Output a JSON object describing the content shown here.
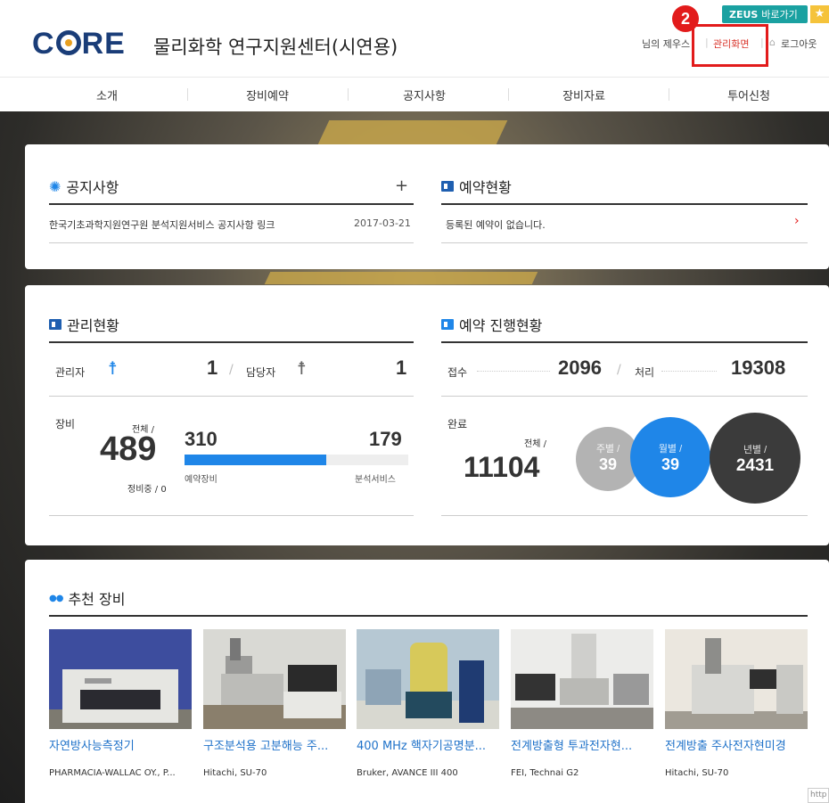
{
  "header": {
    "logo": "CORE",
    "site_title": "물리화학 연구지원센터(시연용)",
    "zeus_label": "ZEUS",
    "zeus_link": "바로가기",
    "user_text": "님의 제우스",
    "admin_link": "관리화면",
    "logout_link": "로그아웃",
    "step_badge": "2"
  },
  "nav": {
    "items": [
      "소개",
      "장비예약",
      "공지사항",
      "장비자료",
      "투어신청"
    ]
  },
  "notice": {
    "title": "공지사항",
    "more": "+",
    "item_text": "한국기초과학지원연구원 분석지원서비스 공지사항 링크",
    "item_date": "2017-03-21"
  },
  "reservation": {
    "title": "예약현황",
    "empty_text": "등록된 예약이 없습니다.",
    "arrow": "›"
  },
  "management": {
    "title": "관리현황",
    "admin_label": "관리자",
    "admin_count": "1",
    "slash": "/",
    "staff_label": "담당자",
    "staff_count": "1",
    "equip_label": "장비",
    "total_label": "전체 /",
    "total": "489",
    "maint_label": "정비중 / 0",
    "reserve_count": "310",
    "analysis_count": "179",
    "reserve_label": "예약장비",
    "analysis_label": "분석서비스",
    "reserve_ratio": 0.634
  },
  "progress": {
    "title": "예약 진행현황",
    "received_label": "접수",
    "received": "2096",
    "slash": "/",
    "processed_label": "처리",
    "processed": "19308",
    "done_label": "완료",
    "total_label": "전체 /",
    "total": "11104",
    "weekly_label": "주별 /",
    "weekly": "39",
    "monthly_label": "월별 /",
    "monthly": "39",
    "yearly_label": "년별 /",
    "yearly": "2431"
  },
  "recommend": {
    "title": "추천 장비",
    "items": [
      {
        "name": "자연방사능측정기",
        "maker": "PHARMACIA-WALLAC OY., P..."
      },
      {
        "name": "구조분석용 고분해능 주...",
        "maker": "Hitachi, SU-70"
      },
      {
        "name": "400 MHz 핵자기공명분...",
        "maker": "Bruker, AVANCE III 400"
      },
      {
        "name": "전계방출형 투과전자현...",
        "maker": "FEI, Technai G2"
      },
      {
        "name": "전계방출 주사전자현미경",
        "maker": "Hitachi, SU-70"
      }
    ],
    "corner_text": "http"
  },
  "colors": {
    "accent": "#1f72c9",
    "red": "#e21b1b",
    "navy": "#1a3d78",
    "teal": "#1aa1a1",
    "grey_circle": "#b3b3b3",
    "blue_circle": "#1f86e8",
    "dark_circle": "#3b3b3b"
  }
}
